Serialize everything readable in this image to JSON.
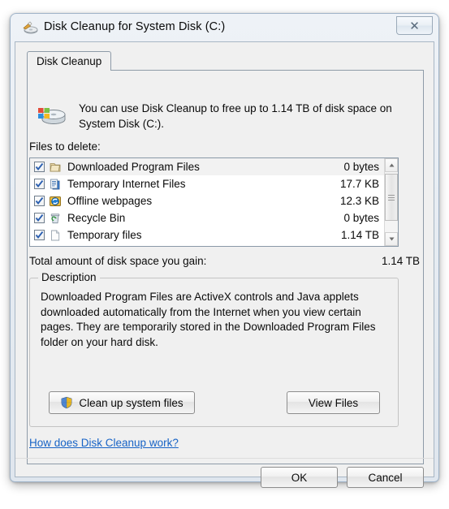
{
  "window": {
    "title": "Disk Cleanup for System Disk (C:)",
    "title_icon": "disk-cleanup-icon",
    "close_glyph": "✕"
  },
  "tabs": [
    {
      "label": "Disk Cleanup",
      "active": true
    }
  ],
  "intro": {
    "icon": "hard-disk-icon",
    "text": "You can use Disk Cleanup to free up to 1.14 TB of disk space on System Disk (C:).",
    "files_to_delete_label": "Files to delete:"
  },
  "file_list": {
    "rows": [
      {
        "label": "Downloaded Program Files",
        "size": "0 bytes",
        "checked": true,
        "selected": true,
        "icon": "folder-icon"
      },
      {
        "label": "Temporary Internet Files",
        "size": "17.7 KB",
        "checked": true,
        "selected": false,
        "icon": "document-pages-icon"
      },
      {
        "label": "Offline webpages",
        "size": "12.3 KB",
        "checked": true,
        "selected": false,
        "icon": "offline-sync-icon"
      },
      {
        "label": "Recycle Bin",
        "size": "0 bytes",
        "checked": true,
        "selected": false,
        "icon": "recycle-bin-icon"
      },
      {
        "label": "Temporary files",
        "size": "1.14 TB",
        "checked": true,
        "selected": false,
        "icon": "blank-page-icon"
      }
    ],
    "scrollbar": {
      "up_arrow": "▲",
      "down_arrow": "▼"
    }
  },
  "total": {
    "label": "Total amount of disk space you gain:",
    "value": "1.14 TB"
  },
  "description": {
    "legend": "Description",
    "text": "Downloaded Program Files are ActiveX controls and Java applets downloaded automatically from the Internet when you view certain pages. They are temporarily stored in the Downloaded Program Files folder on your hard disk.",
    "cleanup_button": "Clean up system files",
    "view_files_button": "View Files",
    "cleanup_button_icon": "uac-shield-icon"
  },
  "help_link": "How does Disk Cleanup work?",
  "footer": {
    "ok": "OK",
    "cancel": "Cancel"
  },
  "colors": {
    "link": "#1763c6",
    "dialog_bg": "#f0f0f0",
    "selection": "#f2f2f2"
  }
}
